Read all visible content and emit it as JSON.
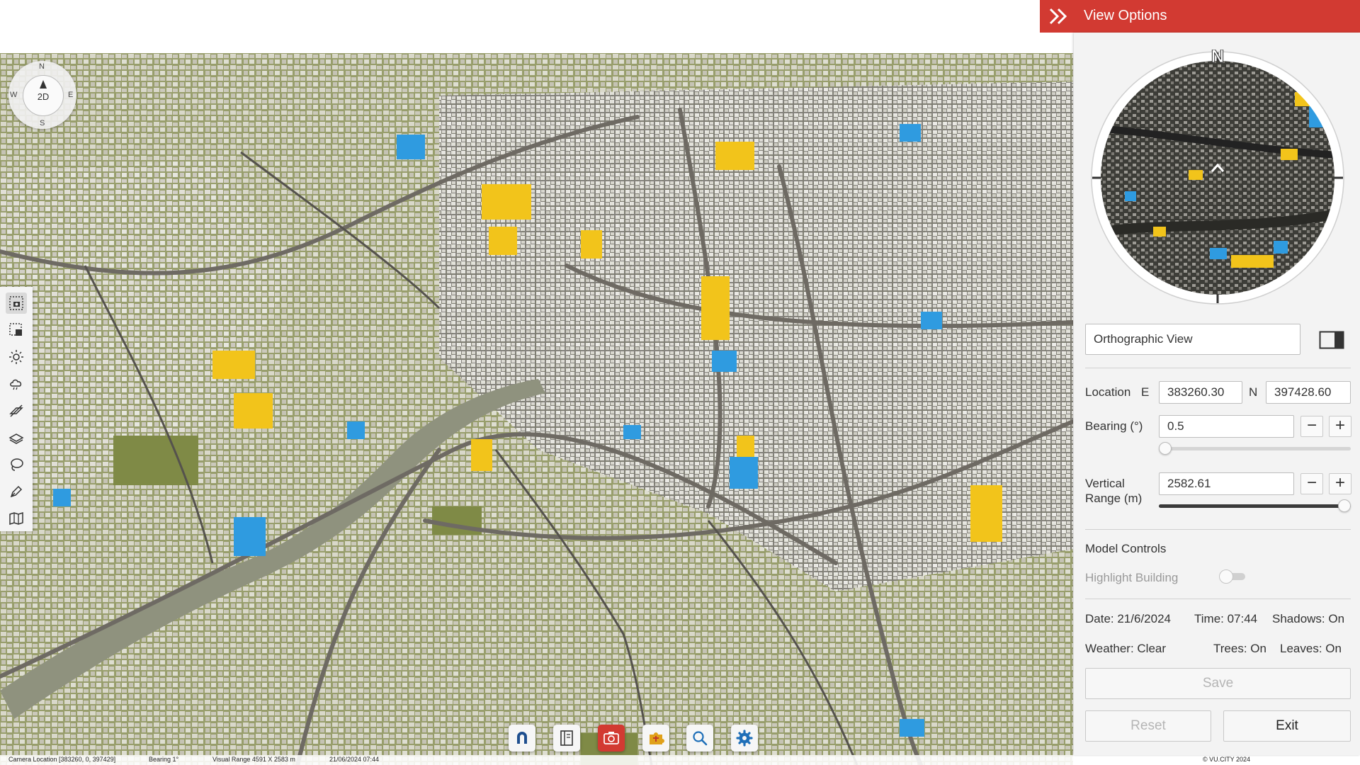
{
  "compass": {
    "n": "N",
    "e": "E",
    "s": "S",
    "w": "W",
    "mode": "2D"
  },
  "left_toolbar": [
    "camera-frame-icon",
    "crop-select-icon",
    "sun-icon",
    "weather-cloud-icon",
    "shadow-toggle-icon",
    "layers-icon",
    "lasso-icon",
    "measure-pen-icon",
    "map-book-icon"
  ],
  "bottom_toolbar": [
    "magnet-icon",
    "document-icon",
    "camera-icon",
    "puzzle-icon",
    "search-icon",
    "settings-icon"
  ],
  "status": {
    "camera_location": "Camera Location  [383260, 0, 397429]",
    "bearing": "Bearing  1°",
    "visual_range": "Visual Range    4591  X  2583 m",
    "datetime": "21/06/2024 07:44",
    "copyright": "© VU.CITY 2024"
  },
  "panel": {
    "title": "View Options",
    "minimap_north": "N",
    "view_mode": "Orthographic View",
    "location": {
      "label": "Location",
      "e_label": "E",
      "e_value": "383260.30",
      "n_label": "N",
      "n_value": "397428.60"
    },
    "bearing": {
      "label": "Bearing (°)",
      "value": "0.5",
      "slider_fraction": 0.0
    },
    "vertical_range": {
      "label_line1": "Vertical",
      "label_line2": "Range (m)",
      "value": "2582.61",
      "slider_fraction": 1.0
    },
    "minus": "−",
    "plus": "+",
    "model_controls": {
      "heading": "Model Controls",
      "highlight_label": "Highlight Building",
      "highlight_on": false
    },
    "info": {
      "date": "Date: 21/6/2024",
      "time": "Time: 07:44",
      "shadows": "Shadows: On",
      "weather": "Weather: Clear",
      "trees": "Trees: On",
      "leaves": "Leaves: On"
    },
    "save_label": "Save",
    "reset_label": "Reset",
    "exit_label": "Exit"
  },
  "colors": {
    "accent_red": "#d23a32",
    "highlight_yellow": "#f2c41b",
    "highlight_blue": "#2f9be0",
    "ground_green": "#8a9150",
    "road_gray": "#6e6a63"
  }
}
